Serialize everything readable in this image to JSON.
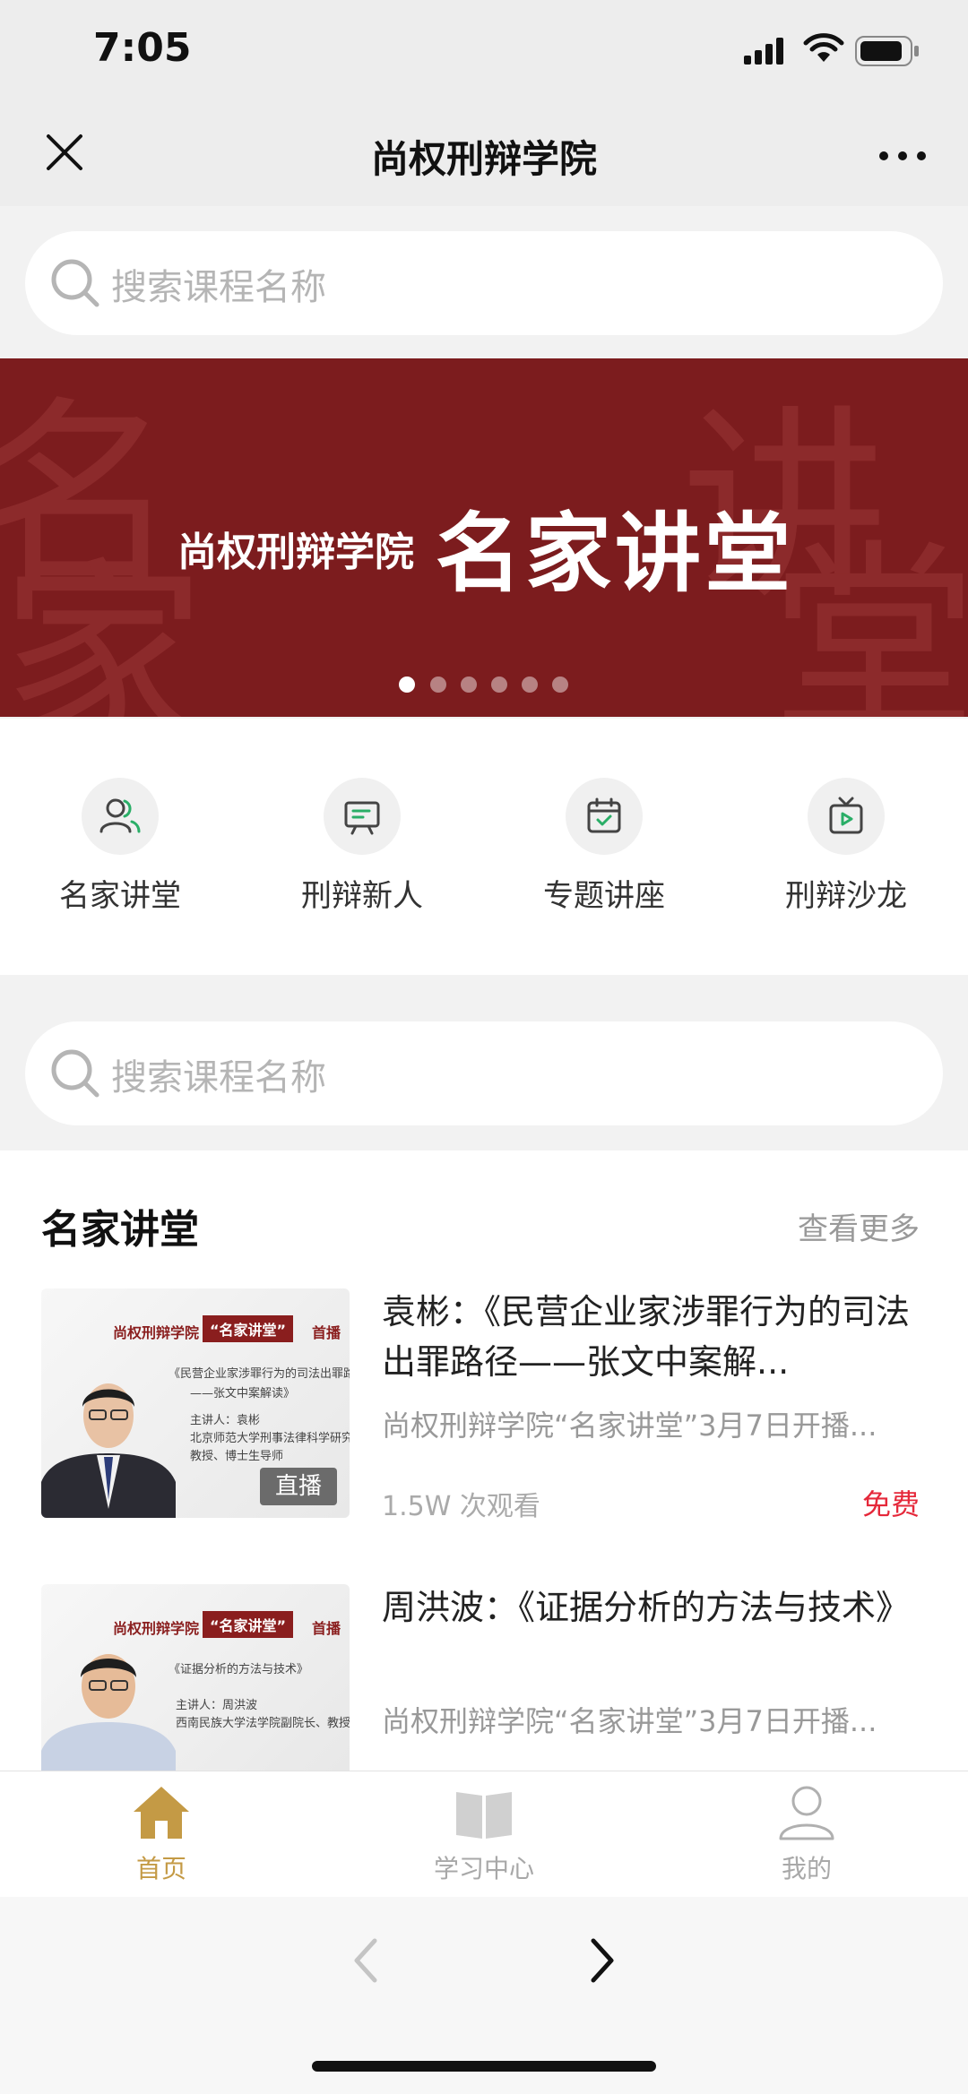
{
  "status": {
    "time": "7:05"
  },
  "header": {
    "title": "尚权刑辩学院"
  },
  "search": {
    "placeholder": "搜索课程名称"
  },
  "banner": {
    "subtitle": "尚权刑辩学院",
    "main": "名家讲堂",
    "bg_chars": [
      "名",
      "家",
      "讲",
      "堂"
    ],
    "dots": 6,
    "active_dot": 0,
    "color": "#7c1c1e"
  },
  "categories": [
    {
      "label": "名家讲堂",
      "icon": "users-icon"
    },
    {
      "label": "刑辩新人",
      "icon": "presentation-icon"
    },
    {
      "label": "专题讲座",
      "icon": "calendar-check-icon"
    },
    {
      "label": "刑辩沙龙",
      "icon": "tv-play-icon"
    }
  ],
  "section": {
    "title": "名家讲堂",
    "more": "查看更多"
  },
  "courses": [
    {
      "title": "袁彬：《民营企业家涉罪行为的司法出罪路径——张文中案解...",
      "desc": "尚权刑辩学院“名家讲堂”3月7日开播...",
      "views": "1.5W 次观看",
      "price": "免费",
      "badge": "直播",
      "thumb": {
        "h1": "尚权刑辩学院",
        "h2": "“名家讲堂”",
        "h3": "首播",
        "line1": "《民营企业家涉罪行为的司法出罪路径",
        "line2": "——张文中案解读》",
        "line3": "主讲人：袁彬",
        "line4": "北京师范大学刑事法律科学研究院",
        "line5": "教授、博士生导师"
      }
    },
    {
      "title": "周洪波：《证据分析的方法与技术》",
      "desc": "尚权刑辩学院“名家讲堂”3月7日开播...",
      "thumb": {
        "h1": "尚权刑辩学院",
        "h2": "“名家讲堂”",
        "h3": "首播",
        "line1": "《证据分析的方法与技术》",
        "line3": "主讲人：周洪波",
        "line4": "西南民族大学法学院副院长、教授"
      }
    }
  ],
  "tabbar": [
    {
      "label": "首页",
      "icon": "home-icon",
      "active": true
    },
    {
      "label": "学习中心",
      "icon": "book-icon",
      "active": false
    },
    {
      "label": "我的",
      "icon": "person-icon",
      "active": false
    }
  ],
  "colors": {
    "accent": "#c49a45",
    "price": "#e5283a",
    "banner": "#7c1c1e"
  }
}
